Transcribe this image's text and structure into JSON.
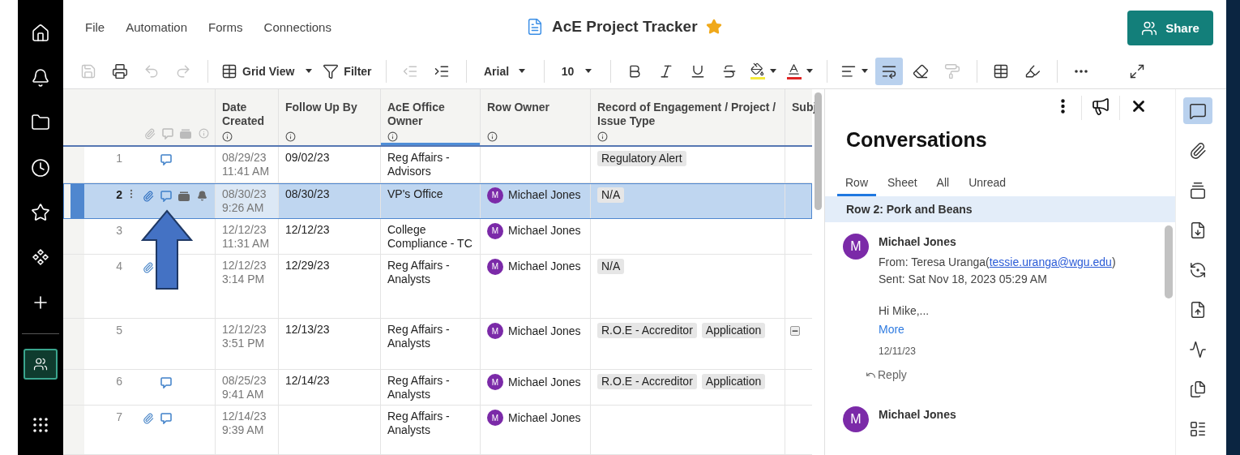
{
  "sidebar": {
    "items": [
      {
        "selected": false
      },
      {
        "selected": false
      },
      {
        "selected": false
      },
      {
        "selected": false
      },
      {
        "selected": false
      },
      {
        "selected": false
      },
      {
        "selected": false
      },
      {
        "selected": true
      },
      {
        "selected": false
      }
    ]
  },
  "menu": [
    "File",
    "Automation",
    "Forms",
    "Connections"
  ],
  "sheet": {
    "title": "AcE Project Tracker",
    "favorite": true
  },
  "share": {
    "label": "Share"
  },
  "toolbar": {
    "save_disabled": true,
    "undo_disabled": true,
    "redo_disabled": true,
    "view_label": "Grid View",
    "filter_label": "Filter",
    "outdent_disabled": true,
    "font": "Arial",
    "font_size": "10",
    "wrap_text_active": true,
    "format_painter_disabled": true
  },
  "grid": {
    "columns": [
      {
        "title": "Date Created",
        "highlighted": false
      },
      {
        "title": "Follow Up By",
        "highlighted": false
      },
      {
        "title": "AcE Office Owner",
        "highlighted": true
      },
      {
        "title": "Row Owner",
        "highlighted": false
      },
      {
        "title": "Record of Engagement / Project / Issue Type",
        "highlighted": false
      },
      {
        "title": "Subj",
        "highlighted": false
      }
    ],
    "rows": [
      {
        "number": "1",
        "selected": false,
        "attachment": false,
        "comment": true,
        "proof": false,
        "reminder": false,
        "date": "08/29/23",
        "time": "11:41 AM",
        "follow_up": "09/02/23",
        "office_owner": "Reg Affairs - Advisors",
        "owner": null,
        "tags": [
          "Regulatory Alert"
        ],
        "collapsed_marker": false
      },
      {
        "number": "2",
        "selected": true,
        "attachment": true,
        "comment": true,
        "proof": true,
        "reminder": true,
        "date": "08/30/23",
        "time": "9:26 AM",
        "follow_up": "08/30/23",
        "office_owner": "VP's Office",
        "owner": {
          "initial": "M",
          "name": "Michael Jones"
        },
        "tags": [
          "N/A"
        ],
        "collapsed_marker": false
      },
      {
        "number": "3",
        "selected": false,
        "attachment": false,
        "comment": false,
        "proof": false,
        "reminder": false,
        "date": "12/12/23",
        "time": "11:31 AM",
        "follow_up": "12/12/23",
        "office_owner": "College Compliance - TC",
        "owner": {
          "initial": "M",
          "name": "Michael Jones"
        },
        "tags": [],
        "collapsed_marker": false
      },
      {
        "number": "4",
        "selected": false,
        "attachment": true,
        "comment": false,
        "proof": false,
        "reminder": false,
        "date": "12/12/23",
        "time": "3:14 PM",
        "follow_up": "12/29/23",
        "office_owner": "Reg Affairs - Analysts",
        "owner": {
          "initial": "M",
          "name": "Michael Jones"
        },
        "tags": [
          "N/A"
        ],
        "collapsed_marker": false
      },
      {
        "number": "5",
        "selected": false,
        "attachment": false,
        "comment": false,
        "proof": false,
        "reminder": false,
        "date": "12/12/23",
        "time": "3:51 PM",
        "follow_up": "12/13/23",
        "office_owner": "Reg Affairs - Analysts",
        "owner": {
          "initial": "M",
          "name": "Michael Jones"
        },
        "tags": [
          "R.O.E - Accreditor",
          "Application"
        ],
        "collapsed_marker": true
      },
      {
        "number": "6",
        "selected": false,
        "attachment": false,
        "comment": true,
        "proof": false,
        "reminder": false,
        "date": "08/25/23",
        "time": "9:41 AM",
        "follow_up": "12/14/23",
        "office_owner": "Reg Affairs - Analysts",
        "owner": {
          "initial": "M",
          "name": "Michael Jones"
        },
        "tags": [
          "R.O.E - Accreditor",
          "Application"
        ],
        "collapsed_marker": false
      },
      {
        "number": "7",
        "selected": false,
        "attachment": true,
        "comment": true,
        "proof": false,
        "reminder": false,
        "date": "12/14/23",
        "time": "9:39 AM",
        "follow_up": "",
        "office_owner": "Reg Affairs - Analysts",
        "owner": {
          "initial": "M",
          "name": "Michael Jones"
        },
        "tags": [],
        "collapsed_marker": false
      }
    ]
  },
  "conversations": {
    "title": "Conversations",
    "tabs": [
      {
        "label": "Row",
        "selected": true
      },
      {
        "label": "Sheet",
        "selected": false
      },
      {
        "label": "All",
        "selected": false
      },
      {
        "label": "Unread",
        "selected": false
      }
    ],
    "context": "Row 2: Pork and Beans",
    "comments": [
      {
        "initial": "M",
        "author": "Michael Jones",
        "from_prefix": "From: Teresa Uranga(",
        "email": "tessie.uranga@wgu.edu",
        "from_suffix": ")",
        "sent": "Sent: Sat Nov 18, 2023 05:29 AM",
        "body": "Hi Mike,...",
        "more": "More",
        "date": "12/11/23",
        "reply": "Reply"
      },
      {
        "initial": "M",
        "author": "Michael Jones"
      }
    ]
  },
  "rail": {
    "items": [
      {
        "selected": true
      },
      {
        "selected": false
      },
      {
        "selected": false
      },
      {
        "selected": false
      },
      {
        "selected": false
      },
      {
        "selected": false
      },
      {
        "selected": false
      },
      {
        "selected": false
      },
      {
        "selected": false
      }
    ]
  }
}
